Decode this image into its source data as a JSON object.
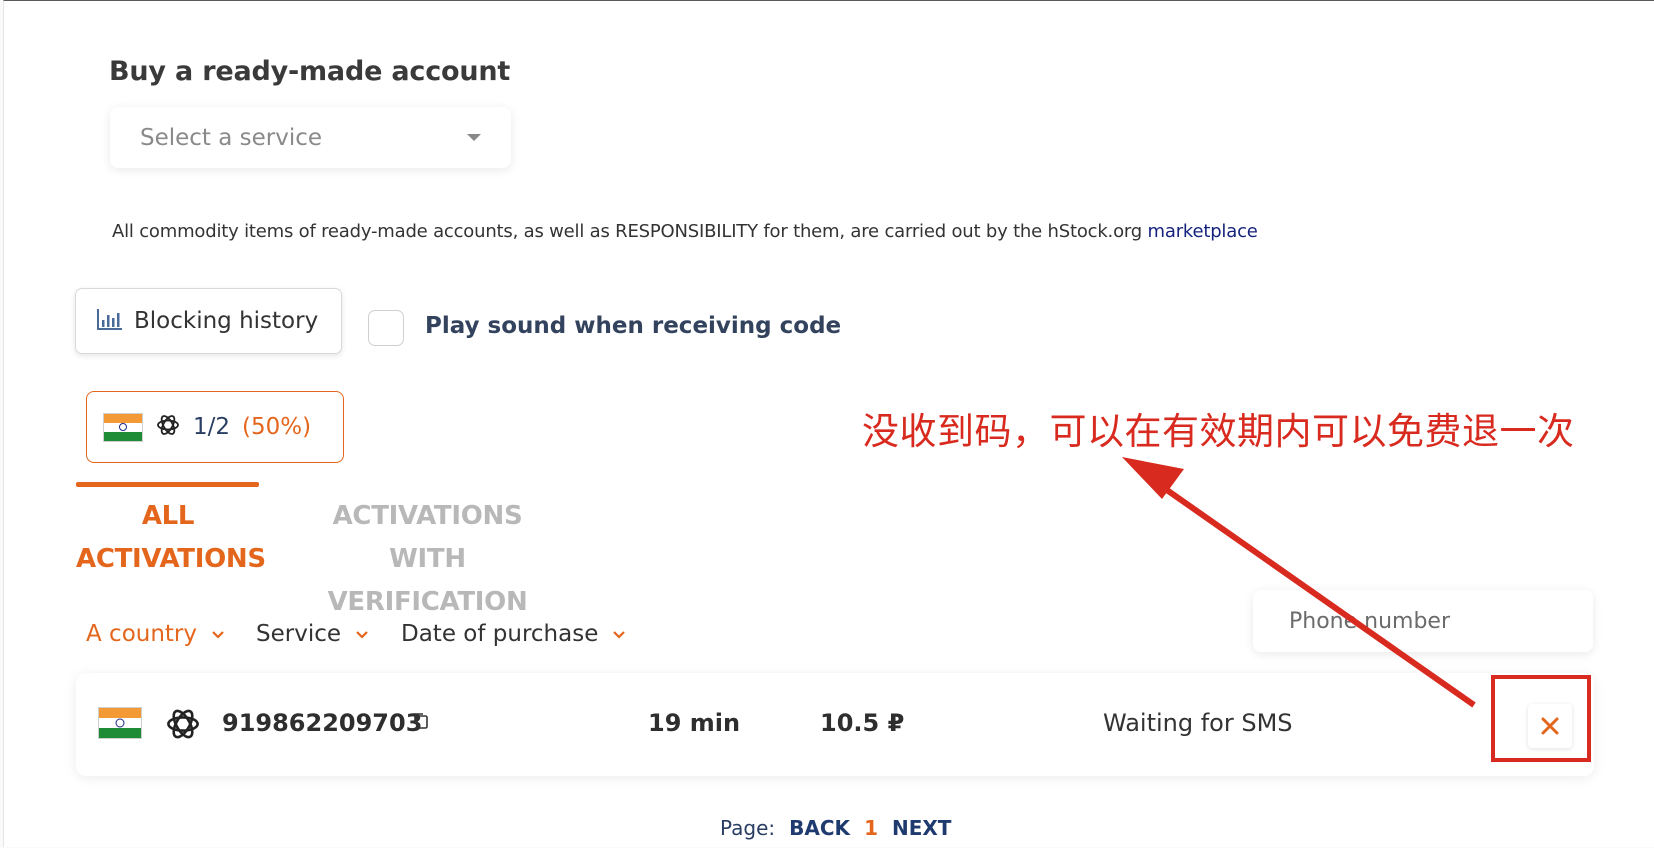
{
  "page": {
    "title": "Buy a ready-made account",
    "service_select": {
      "placeholder": "Select a service"
    },
    "notice": {
      "text": "All commodity items of ready-made accounts, as well as RESPONSIBILITY for them, are carried out by the hStock.org ",
      "link_text": "marketplace"
    }
  },
  "toolbar": {
    "blocking_history_label": "Blocking history",
    "play_sound_label": "Play sound when receiving code",
    "play_sound_checked": false
  },
  "stats": {
    "country_flag": "india-flag-icon",
    "service_icon": "openai-icon",
    "ratio": "1/2",
    "percent": "(50%)"
  },
  "tabs": [
    {
      "line1": "ALL",
      "line2": "ACTIVATIONS",
      "active": true
    },
    {
      "line1": "ACTIVATIONS",
      "line2": "WITH VERIFICATION",
      "active": false
    }
  ],
  "filters": {
    "country": "A country",
    "service": "Service",
    "date": "Date of purchase",
    "phone_placeholder": "Phone number"
  },
  "activations": [
    {
      "flag": "india-flag-icon",
      "service_icon": "openai-icon",
      "phone": "919862209703",
      "time": "19 min",
      "price": "10.5 ₽",
      "status": "Waiting for SMS"
    }
  ],
  "pagination": {
    "label": "Page:",
    "back": "BACK",
    "current": "1",
    "next": "NEXT"
  },
  "annotation": {
    "text": "没收到码，可以在有效期内可以免费退一次",
    "color": "#d82a1f"
  },
  "colors": {
    "accent": "#e4661c",
    "navy": "#2a3e63",
    "link": "#16237e"
  }
}
